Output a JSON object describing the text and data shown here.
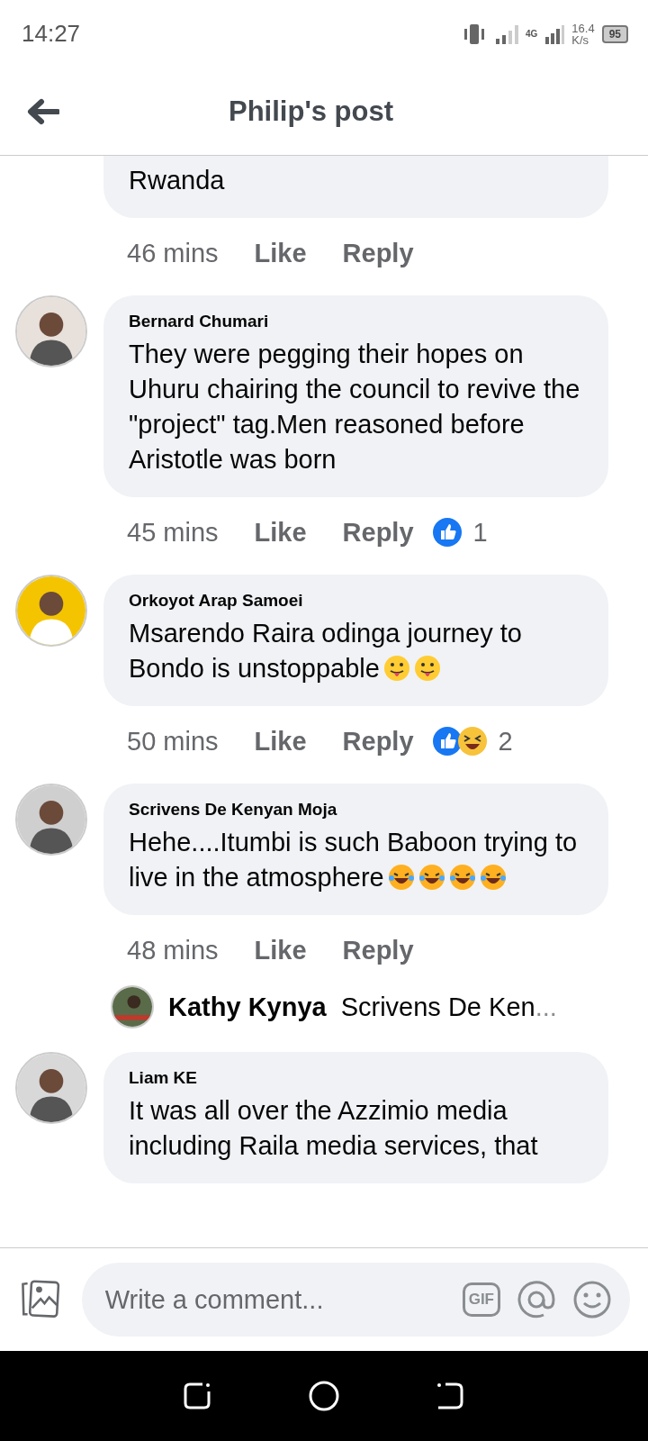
{
  "status_bar": {
    "time": "14:27",
    "network": "4G",
    "speed": "16.4",
    "speed_unit": "K/s",
    "battery": "95"
  },
  "header": {
    "title": "Philip's post"
  },
  "comments": [
    {
      "text": "Rwanda",
      "time": "46 mins",
      "like": "Like",
      "reply": "Reply"
    },
    {
      "author": "Bernard Chumari",
      "text": "They were pegging their hopes on Uhuru chairing the council to revive the \"project\" tag.Men reasoned before Aristotle was born",
      "time": "45 mins",
      "like": "Like",
      "reply": "Reply",
      "reactions": [
        {
          "kind": "like"
        }
      ],
      "reaction_count": "1"
    },
    {
      "author": "Orkoyot Arap Samoei",
      "text": "Msarendo Raira odinga journey to Bondo is unstoppable",
      "emojis": [
        {
          "kind": "tongue"
        },
        {
          "kind": "tongue"
        }
      ],
      "time": "50 mins",
      "like": "Like",
      "reply": "Reply",
      "reactions": [
        {
          "kind": "like"
        },
        {
          "kind": "haha"
        }
      ],
      "reaction_count": "2"
    },
    {
      "author": "Scrivens De Kenyan Moja",
      "text": "Hehe....Itumbi is such Baboon trying to live in the atmosphere",
      "emojis": [
        {
          "kind": "tears"
        },
        {
          "kind": "tears"
        },
        {
          "kind": "tears"
        },
        {
          "kind": "tears"
        }
      ],
      "time": "48 mins",
      "like": "Like",
      "reply": "Reply",
      "reply_preview": {
        "author": "Kathy Kynya",
        "text": "Scrivens De Ken",
        "ellipsis": "..."
      }
    },
    {
      "author": "Liam KE",
      "text": "It was all over the Azzimio media including Raila media services, that"
    }
  ],
  "composer": {
    "placeholder": "Write a comment...",
    "gif": "GIF"
  }
}
